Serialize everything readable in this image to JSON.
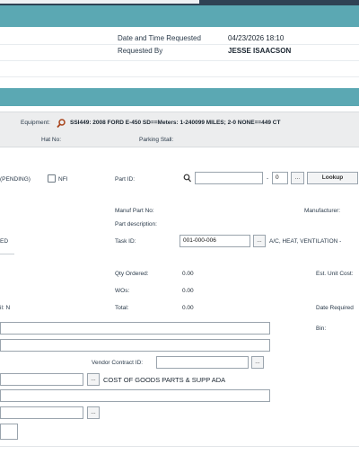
{
  "header": {
    "datetime_label": "Date and Time Requested",
    "datetime_value": "04/23/2026 18:10",
    "requested_by_label": "Requested By",
    "requested_by_value": "JESSE ISAACSON"
  },
  "equipment_bar": {
    "equipment_label": "Equipment:",
    "equipment_value": "SSI449: 2008 FORD E-450 SD==Meters: 1-240099 MILES; 2-0 NONE==449 CT",
    "hat_no_label": "Hat No:",
    "parking_stall_label": "Parking Stall:"
  },
  "form": {
    "status_fragment": "(PENDING)",
    "nfi_label": "NFI",
    "part_id_label": "Part ID:",
    "part_id_value": "",
    "part_suffix_sep": "-",
    "part_suffix_value": "0",
    "ellipsis": "...",
    "lookup_label": "Lookup",
    "manuf_part_no_label": "Manuf Part No:",
    "manufacturer_label": "Manufacturer:",
    "part_description_label": "Part description:",
    "left_fragment_ed": "ED",
    "task_id_label": "Task ID:",
    "task_id_value": "001-000-006",
    "task_desc": "A/C, HEAT, VENTILATION -",
    "qty_ordered_label": "Qty Ordered:",
    "qty_ordered_value": "0.00",
    "est_unit_cost_label": "Est. Unit Cost:",
    "wos_label": "WOs:",
    "wos_value": "0.00",
    "left_fragment_il": "il: N",
    "total_label": "Total:",
    "total_value": "0.00",
    "date_required_label": "Date Required",
    "bin_label": "Bin:",
    "vendor_contract_label": "Vendor Contract ID:",
    "account_desc": "COST OF GOODS PARTS & SUPP ADA"
  }
}
